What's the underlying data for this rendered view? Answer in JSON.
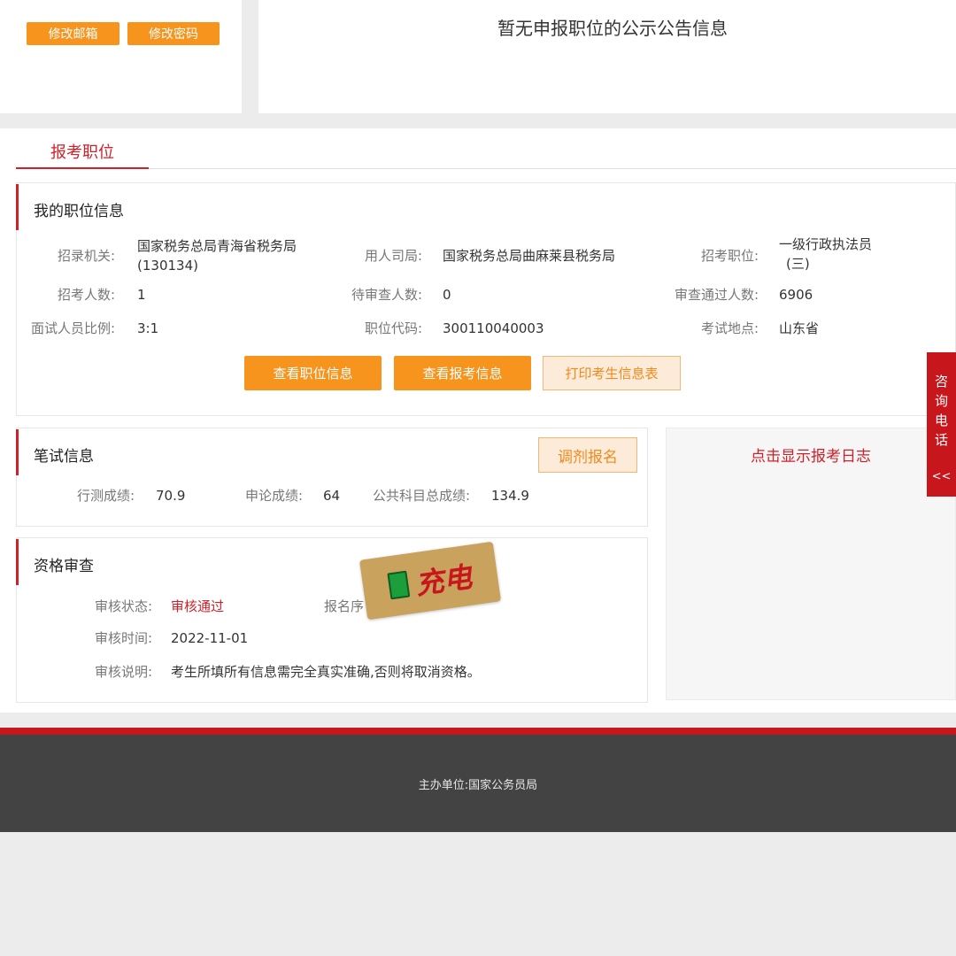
{
  "top": {
    "change_email": "修改邮箱",
    "change_password": "修改密码",
    "notice": "暂无申报职位的公示公告信息"
  },
  "tab": {
    "active": "报考职位"
  },
  "position_card": {
    "title": "我的职位信息",
    "fields": {
      "agency_label": "招录机关:",
      "agency_value_line1": "国家税务总局青海省税务局",
      "agency_value_line2": "(130134)",
      "dept_label": "用人司局:",
      "dept_value": "国家税务总局曲麻莱县税务局",
      "post_label": "招考职位:",
      "post_value_line1": "一级行政执法员",
      "post_value_line2": "(三)",
      "recruit_label": "招考人数:",
      "recruit_value": "1",
      "pending_label": "待审查人数:",
      "pending_value": "0",
      "passed_label": "审查通过人数:",
      "passed_value": "6906",
      "ratio_label": "面试人员比例:",
      "ratio_value": "3:1",
      "code_label": "职位代码:",
      "code_value": "300110040003",
      "location_label": "考试地点:",
      "location_value": "山东省"
    },
    "buttons": {
      "view_position": "查看职位信息",
      "view_application": "查看报考信息",
      "print_form": "打印考生信息表"
    }
  },
  "exam_card": {
    "title": "笔试信息",
    "adjust_button": "调剂报名",
    "xingce_label": "行测成绩:",
    "xingce_value": "70.9",
    "shenlun_label": "申论成绩:",
    "shenlun_value": "64",
    "total_label": "公共科目总成绩:",
    "total_value": "134.9"
  },
  "log_panel": {
    "link": "点击显示报考日志"
  },
  "review_card": {
    "title": "资格审查",
    "status_label": "审核状态:",
    "status_value": "审核通过",
    "serial_label": "报名序",
    "time_label": "审核时间:",
    "time_value": "2022-11-01",
    "note_label": "审核说明:",
    "note_value": "考生所填所有信息需完全真实准确,否则将取消资格。"
  },
  "side_tab": {
    "chars": [
      "咨",
      "询",
      "电",
      "话"
    ],
    "arrow": "<<"
  },
  "sticker": {
    "text": "充电"
  },
  "footer": {
    "text": "主办单位:国家公务员局"
  },
  "colors": {
    "accent_red": "#d0202a",
    "orange": "#f7941d",
    "footer_bg": "#434343"
  }
}
